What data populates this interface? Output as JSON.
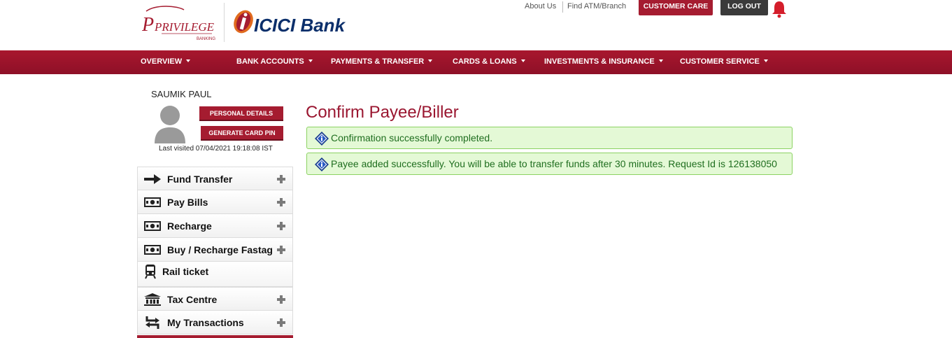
{
  "header": {
    "privilege_logo_text": "PRIVILEGE",
    "privilege_logo_sub": "BANKING",
    "bank_logo_text": "ICICI Bank",
    "links": {
      "about": "About Us",
      "find_atm": "Find ATM/Branch"
    },
    "customer_care_label": "CUSTOMER CARE",
    "logout_label": "LOG OUT"
  },
  "nav": {
    "items": [
      {
        "label": "OVERVIEW"
      },
      {
        "label": "BANK ACCOUNTS"
      },
      {
        "label": "PAYMENTS & TRANSFER"
      },
      {
        "label": "CARDS & LOANS"
      },
      {
        "label": "INVESTMENTS & INSURANCE"
      },
      {
        "label": "CUSTOMER SERVICE"
      }
    ]
  },
  "profile": {
    "name": "SAUMIK PAUL",
    "personal_details_label": "PERSONAL DETAILS",
    "generate_pin_label": "GENERATE CARD PIN",
    "last_visited": "Last visited 07/04/2021 19:18:08 IST"
  },
  "sidebar": {
    "items": [
      {
        "label": "Fund Transfer",
        "icon": "arrow-right-icon"
      },
      {
        "label": "Pay Bills",
        "icon": "banknote-icon"
      },
      {
        "label": "Recharge",
        "icon": "banknote-icon"
      },
      {
        "label": "Buy / Recharge Fastag",
        "icon": "banknote-icon"
      },
      {
        "label": "Rail ticket",
        "icon": "train-icon"
      },
      {
        "label": "Tax Centre",
        "icon": "bank-building-icon"
      },
      {
        "label": "My Transactions",
        "icon": "swap-arrows-icon"
      }
    ]
  },
  "main": {
    "title": "Confirm Payee/Biller",
    "messages": [
      {
        "text": "Confirmation successfully completed."
      },
      {
        "text": "Payee added successfully. You will be able to transfer funds after 30 minutes. Request Id is 126138050"
      }
    ]
  },
  "colors": {
    "brand": "#a51c30",
    "nav_bg": "#9c132b",
    "success_bg": "#e4f9d6",
    "success_border": "#8cd262",
    "success_text": "#1f6e1f"
  }
}
